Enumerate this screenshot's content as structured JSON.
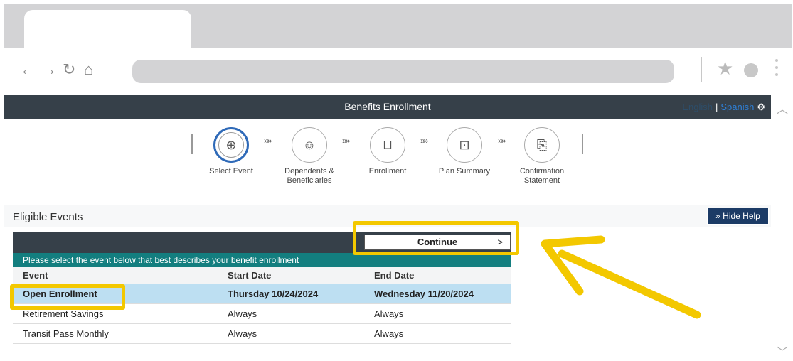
{
  "app": {
    "title": "Benefits Enrollment",
    "lang_english": "English",
    "lang_sep": "|",
    "lang_spanish": "Spanish"
  },
  "steps": [
    {
      "label": "Select Event",
      "icon": "plus-icon",
      "glyph": "⊕"
    },
    {
      "label": "Dependents & Beneficiaries",
      "icon": "people-icon",
      "glyph": "☺"
    },
    {
      "label": "Enrollment",
      "icon": "cart-icon",
      "glyph": "🛒"
    },
    {
      "label": "Plan Summary",
      "icon": "chart-icon",
      "glyph": "📈"
    },
    {
      "label": "Confirmation Statement",
      "icon": "document-icon",
      "glyph": "📄"
    }
  ],
  "events": {
    "title": "Eligible Events",
    "hide_help": "Hide Help",
    "continue_label": "Continue",
    "instruction": "Please select the event below that best describes your benefit enrollment",
    "columns": [
      "Event",
      "Start Date",
      "End Date"
    ],
    "rows": [
      {
        "event": "Open Enrollment",
        "start": "Thursday 10/24/2024",
        "end": "Wednesday 11/20/2024",
        "selected": true
      },
      {
        "event": "Retirement Savings",
        "start": "Always",
        "end": "Always",
        "selected": false
      },
      {
        "event": "Transit Pass Monthly",
        "start": "Always",
        "end": "Always",
        "selected": false
      }
    ]
  },
  "colors": {
    "accent_highlight": "#f3c800",
    "header_dark": "#364049",
    "teal": "#137e7f",
    "selected_row": "#bddff2",
    "help_button": "#1c3b66"
  }
}
